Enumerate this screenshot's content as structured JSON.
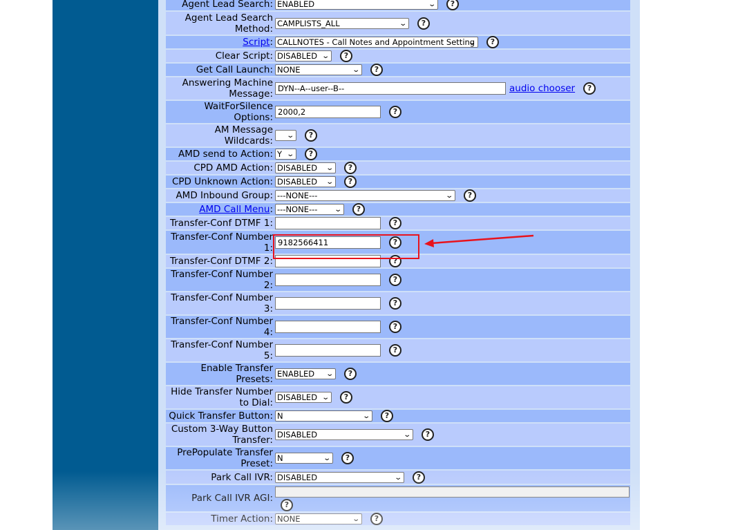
{
  "rows": {
    "agent_lead_search": {
      "label": "Agent Lead Search:",
      "value": "ENABLED"
    },
    "agent_lead_search_method": {
      "label": "Agent Lead Search Method:",
      "value": "CAMPLISTS_ALL"
    },
    "script": {
      "label_link": "Script",
      "label_suffix": ":",
      "value": "CALLNOTES - Call Notes and Appointment Setting"
    },
    "clear_script": {
      "label": "Clear Script:",
      "value": "DISABLED"
    },
    "get_call_launch": {
      "label": "Get Call Launch:",
      "value": "NONE"
    },
    "answering_machine_message": {
      "label": "Answering Machine Message:",
      "value": "DYN--A--user--B--",
      "link": "audio chooser"
    },
    "wait_for_silence": {
      "label": "WaitForSilence Options:",
      "value": "2000,2"
    },
    "am_message_wildcards": {
      "label": "AM Message Wildcards:",
      "value": ""
    },
    "amd_send_to_action": {
      "label": "AMD send to Action:",
      "value": "Y"
    },
    "cpd_amd_action": {
      "label": "CPD AMD Action:",
      "value": "DISABLED"
    },
    "cpd_unknown_action": {
      "label": "CPD Unknown Action:",
      "value": "DISABLED"
    },
    "amd_inbound_group": {
      "label": "AMD Inbound Group:",
      "value": "---NONE---"
    },
    "amd_call_menu": {
      "label_link": "AMD Call Menu",
      "label_suffix": ":",
      "value": "---NONE---"
    },
    "transfer_conf_dtmf_1": {
      "label": "Transfer-Conf DTMF 1:",
      "value": ""
    },
    "transfer_conf_number_1": {
      "label": "Transfer-Conf Number 1:",
      "value": "9182566411"
    },
    "transfer_conf_dtmf_2": {
      "label": "Transfer-Conf DTMF 2:",
      "value": ""
    },
    "transfer_conf_number_2": {
      "label": "Transfer-Conf Number 2:",
      "value": ""
    },
    "transfer_conf_number_3": {
      "label": "Transfer-Conf Number 3:",
      "value": ""
    },
    "transfer_conf_number_4": {
      "label": "Transfer-Conf Number 4:",
      "value": ""
    },
    "transfer_conf_number_5": {
      "label": "Transfer-Conf Number 5:",
      "value": ""
    },
    "enable_transfer_presets": {
      "label": "Enable Transfer Presets:",
      "value": "ENABLED"
    },
    "hide_transfer_number": {
      "label": "Hide Transfer Number to Dial:",
      "value": "DISABLED"
    },
    "quick_transfer_button": {
      "label": "Quick Transfer Button:",
      "value": "N"
    },
    "custom_3way_button": {
      "label": "Custom 3-Way Button Transfer:",
      "value": "DISABLED"
    },
    "prepopulate_transfer_preset": {
      "label": "PrePopulate Transfer Preset:",
      "value": "N"
    },
    "park_call_ivr": {
      "label": "Park Call IVR:",
      "value": "DISABLED"
    },
    "park_call_ivr_agi": {
      "label": "Park Call IVR AGI:",
      "value": ""
    },
    "timer_action": {
      "label": "Timer Action:",
      "value": "NONE"
    }
  },
  "help_glyph": "?",
  "colors": {
    "sidebar": "#015B91",
    "panel": "#CFE0F8",
    "row_light": "#B9CBFD",
    "row_dark": "#9BB9FB",
    "highlight": "#e8121c"
  }
}
